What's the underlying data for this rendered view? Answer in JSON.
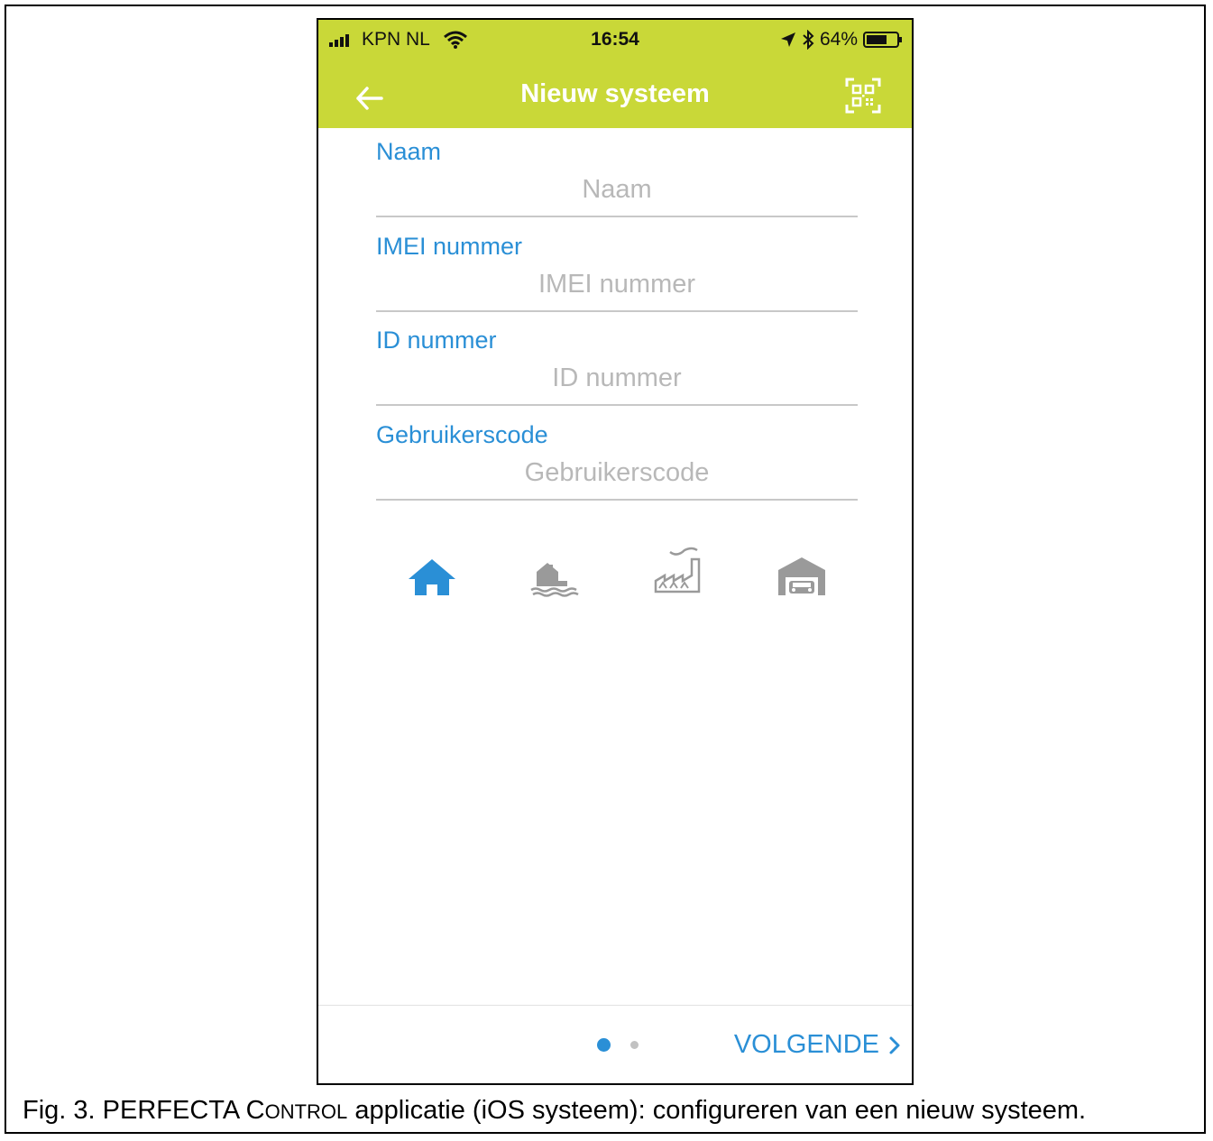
{
  "status_bar": {
    "carrier": "KPN NL",
    "time": "16:54",
    "battery": "64%"
  },
  "nav": {
    "title": "Nieuw systeem"
  },
  "form": {
    "fields": [
      {
        "label": "Naam",
        "placeholder": "Naam"
      },
      {
        "label": "IMEI nummer",
        "placeholder": "IMEI nummer"
      },
      {
        "label": "ID nummer",
        "placeholder": "ID nummer"
      },
      {
        "label": "Gebruikerscode",
        "placeholder": "Gebruikerscode"
      }
    ]
  },
  "system_types": [
    {
      "icon": "home-icon",
      "selected": true
    },
    {
      "icon": "lake-house-icon",
      "selected": false
    },
    {
      "icon": "factory-icon",
      "selected": false
    },
    {
      "icon": "garage-icon",
      "selected": false
    }
  ],
  "pager": {
    "pages": 2,
    "current": 1
  },
  "footer": {
    "next_label": "VOLGENDE"
  },
  "caption": {
    "prefix": "Fig. 3. PERFECTA C",
    "smallcaps": "ONTROL",
    "suffix": " applicatie (iOS systeem): configureren van een nieuw systeem."
  },
  "colors": {
    "header": "#c9d838",
    "accent": "#2a8fd6",
    "inactive_icon": "#9a9a9a"
  }
}
